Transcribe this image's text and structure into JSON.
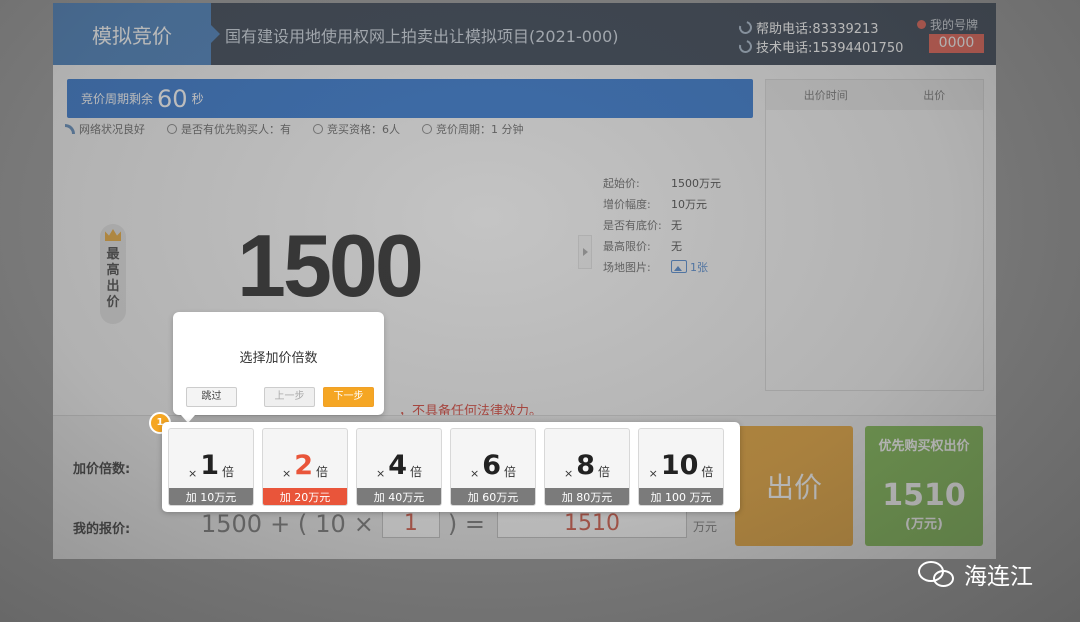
{
  "header": {
    "logo": "模拟竞价",
    "project_title": "国有建设用地使用权网上拍卖出让模拟项目(2021-000)",
    "help_phone": "帮助电话:83339213",
    "tech_phone": "技术电话:15394401750",
    "my_number_label": "我的号牌",
    "my_number": "0000"
  },
  "countdown": {
    "label": "竞价周期剩余",
    "seconds": "60",
    "unit": "秒"
  },
  "status": {
    "network": "网络状况良好",
    "priority_buyer": "是否有优先购买人：有",
    "qualification": "竞买资格：6人",
    "cycle": "竞价周期：1 分钟"
  },
  "history": {
    "col_time": "出价时间",
    "col_bid": "出价"
  },
  "highest": {
    "label": "最高出价",
    "price": "1500"
  },
  "info": [
    {
      "k": "起始价:",
      "v": "1500万元"
    },
    {
      "k": "增价幅度:",
      "v": "10万元"
    },
    {
      "k": "是否有底价:",
      "v": "无"
    },
    {
      "k": "最高限价:",
      "v": "无"
    },
    {
      "k": "场地图片:",
      "v": "1张"
    }
  ],
  "guide": {
    "title": "选择加价倍数",
    "skip": "跳过",
    "prev": "上一步",
    "next": "下一步",
    "step": "1"
  },
  "disclaimer": "，不具备任何法律效力。",
  "labels": {
    "multiplier": "加价倍数:",
    "my_quote": "我的报价:",
    "unit": "万元"
  },
  "multipliers": [
    {
      "x": "×",
      "n": "1",
      "bei": "倍",
      "add": "加 10万元"
    },
    {
      "x": "×",
      "n": "2",
      "bei": "倍",
      "add": "加 20万元"
    },
    {
      "x": "×",
      "n": "4",
      "bei": "倍",
      "add": "加 40万元"
    },
    {
      "x": "×",
      "n": "6",
      "bei": "倍",
      "add": "加 60万元"
    },
    {
      "x": "×",
      "n": "8",
      "bei": "倍",
      "add": "加 80万元"
    },
    {
      "x": "×",
      "n": "10",
      "bei": "倍",
      "add": "加 100 万元"
    }
  ],
  "formula": {
    "base": "1500",
    "plus_open": "+ (",
    "step": "10",
    "times": "×",
    "mult": "1",
    "close_eq": ") =",
    "result": "1510"
  },
  "buttons": {
    "bid": "出价",
    "priority_title": "优先购买权出价",
    "priority_amount": "1510",
    "priority_unit": "(万元)"
  },
  "watermark": "海连江",
  "colors": {
    "accent_blue": "#1b66c9",
    "orange": "#e49a1f",
    "green": "#6fb13a",
    "red": "#e9553a"
  }
}
